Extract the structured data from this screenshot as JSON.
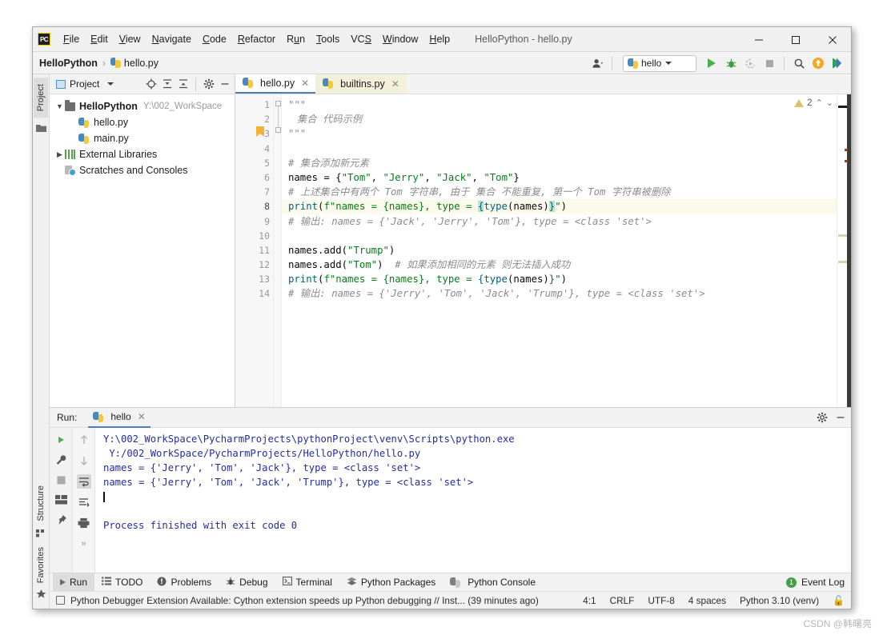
{
  "window": {
    "title": "HelloPython - hello.py",
    "logo": "pycharm-logo",
    "controls": {
      "minimize": "minimize-icon",
      "maximize": "maximize-icon",
      "close": "close-icon"
    }
  },
  "menubar": {
    "items": [
      {
        "label": "File",
        "mnemonic": "F"
      },
      {
        "label": "Edit",
        "mnemonic": "E"
      },
      {
        "label": "View",
        "mnemonic": "V"
      },
      {
        "label": "Navigate",
        "mnemonic": "N"
      },
      {
        "label": "Code",
        "mnemonic": "C"
      },
      {
        "label": "Refactor",
        "mnemonic": "R"
      },
      {
        "label": "Run",
        "mnemonic": "n"
      },
      {
        "label": "Tools",
        "mnemonic": "T"
      },
      {
        "label": "VCS",
        "mnemonic": "S"
      },
      {
        "label": "Window",
        "mnemonic": "W"
      },
      {
        "label": "Help",
        "mnemonic": "H"
      }
    ]
  },
  "navbar": {
    "breadcrumb": {
      "project": "HelloPython",
      "separator": "›",
      "file": "hello.py"
    },
    "run_config": "hello",
    "icons": {
      "account": "account-icon",
      "run": "run-icon",
      "debug": "debug-icon",
      "run_coverage": "run-with-coverage-icon",
      "stop": "stop-icon",
      "search": "search-everywhere-icon",
      "update": "update-project-icon",
      "next": "next-icon"
    }
  },
  "left_rail": {
    "top_label": "Project",
    "bottom_labels": [
      "Structure",
      "Favorites"
    ]
  },
  "project_panel": {
    "title": "Project",
    "actions": [
      "locate-icon",
      "collapse-all-icon",
      "expand-all-icon",
      "gear-icon",
      "hide-icon"
    ],
    "tree": [
      {
        "name": "HelloPython",
        "path": "Y:\\002_WorkSpace",
        "type": "folder",
        "expanded": true,
        "depth": 0,
        "bold": true
      },
      {
        "name": "hello.py",
        "path": "",
        "type": "python-file",
        "depth": 1,
        "bold": false
      },
      {
        "name": "main.py",
        "path": "",
        "type": "python-file",
        "depth": 1,
        "bold": false
      },
      {
        "name": "External Libraries",
        "path": "",
        "type": "library",
        "expanded": false,
        "depth": 0,
        "bold": false
      },
      {
        "name": "Scratches and Consoles",
        "path": "",
        "type": "scratch",
        "depth": 0,
        "bold": false
      }
    ]
  },
  "editor": {
    "tabs": [
      {
        "label": "hello.py",
        "active": true
      },
      {
        "label": "builtins.py",
        "active": false
      }
    ],
    "warnings": {
      "count": "2",
      "icon": "warning-icon"
    },
    "bookmark_line": 3,
    "current_line": 8,
    "lines": [
      {
        "n": 1,
        "tokens": [
          {
            "t": "\"\"\"",
            "c": "cmt"
          }
        ]
      },
      {
        "n": 2,
        "tokens": [
          {
            "t": "集合 代码示例",
            "c": "cmt"
          }
        ]
      },
      {
        "n": 3,
        "tokens": [
          {
            "t": "\"\"\"",
            "c": "cmt"
          }
        ]
      },
      {
        "n": 4,
        "tokens": []
      },
      {
        "n": 5,
        "tokens": [
          {
            "t": "# 集合添加新元素",
            "c": "cmt"
          }
        ]
      },
      {
        "n": 6,
        "tokens": [
          {
            "t": "names ",
            "c": "pln"
          },
          {
            "t": "= ",
            "c": "pln"
          },
          {
            "t": "{",
            "c": "pln"
          },
          {
            "t": "\"Tom\"",
            "c": "str"
          },
          {
            "t": ", ",
            "c": "pln"
          },
          {
            "t": "\"Jerry\"",
            "c": "str"
          },
          {
            "t": ", ",
            "c": "pln"
          },
          {
            "t": "\"Jack\"",
            "c": "str"
          },
          {
            "t": ", ",
            "c": "pln"
          },
          {
            "t": "\"Tom\"",
            "c": "str"
          },
          {
            "t": "}",
            "c": "pln"
          }
        ]
      },
      {
        "n": 7,
        "tokens": [
          {
            "t": "# 上述集合中有两个 Tom 字符串, 由于 集合 不能重复, 第一个 Tom 字符串被删除",
            "c": "cmt"
          }
        ]
      },
      {
        "n": 8,
        "tokens": [
          {
            "t": "print",
            "c": "fn"
          },
          {
            "t": "(",
            "c": "pln"
          },
          {
            "t": "f\"names = {names}, type = ",
            "c": "str"
          },
          {
            "t": "{",
            "c": "bracehl"
          },
          {
            "t": "type",
            "c": "fn"
          },
          {
            "t": "(names)",
            "c": "pln"
          },
          {
            "t": "}",
            "c": "bracehl"
          },
          {
            "t": "\"",
            "c": "str"
          },
          {
            "t": ")",
            "c": "pln"
          }
        ]
      },
      {
        "n": 9,
        "tokens": [
          {
            "t": "# 输出: names = {'Jack', 'Jerry', 'Tom'}, type = <class 'set'>",
            "c": "cmt"
          }
        ]
      },
      {
        "n": 10,
        "tokens": []
      },
      {
        "n": 11,
        "tokens": [
          {
            "t": "names.add",
            "c": "pln"
          },
          {
            "t": "(",
            "c": "pln"
          },
          {
            "t": "\"Trump\"",
            "c": "str"
          },
          {
            "t": ")",
            "c": "pln"
          }
        ]
      },
      {
        "n": 12,
        "tokens": [
          {
            "t": "names.add",
            "c": "pln"
          },
          {
            "t": "(",
            "c": "pln"
          },
          {
            "t": "\"Tom\"",
            "c": "str"
          },
          {
            "t": ")  ",
            "c": "pln"
          },
          {
            "t": "# 如果添加相同的元素 则无法插入成功",
            "c": "cmt"
          }
        ]
      },
      {
        "n": 13,
        "tokens": [
          {
            "t": "print",
            "c": "fn"
          },
          {
            "t": "(",
            "c": "pln"
          },
          {
            "t": "f\"names = {names}, type = ",
            "c": "str"
          },
          {
            "t": "{",
            "c": "pln"
          },
          {
            "t": "type",
            "c": "fn"
          },
          {
            "t": "(names)",
            "c": "pln"
          },
          {
            "t": "}",
            "c": "pln"
          },
          {
            "t": "\"",
            "c": "str"
          },
          {
            "t": ")",
            "c": "pln"
          }
        ]
      },
      {
        "n": 14,
        "tokens": [
          {
            "t": "# 输出: names = {'Jerry', 'Tom', 'Jack', 'Trump'}, type = <class 'set'>",
            "c": "cmt"
          }
        ]
      }
    ]
  },
  "run_panel": {
    "label": "Run:",
    "tab": "hello",
    "toolbar_left": [
      "rerun-icon",
      "settings-wrench-icon",
      "stop-icon",
      "layout-icon",
      "pin-icon"
    ],
    "toolbar_right": [
      "up-icon",
      "down-icon",
      "soft-wrap-icon",
      "scroll-to-end-icon",
      "print-icon",
      "more-icon"
    ],
    "header_right": [
      "gear-icon",
      "hide-icon"
    ],
    "console": [
      "Y:\\002_WorkSpace\\PycharmProjects\\pythonProject\\venv\\Scripts\\python.exe",
      " Y:/002_WorkSpace/PycharmProjects/HelloPython/hello.py",
      "names = {'Jerry', 'Tom', 'Jack'}, type = <class 'set'>",
      "names = {'Jerry', 'Tom', 'Jack', 'Trump'}, type = <class 'set'>",
      "",
      "",
      "Process finished with exit code 0"
    ]
  },
  "bottom_bar": {
    "items": [
      {
        "label": "Run",
        "icon": "run-icon",
        "active": true
      },
      {
        "label": "TODO",
        "icon": "todo-icon",
        "active": false
      },
      {
        "label": "Problems",
        "icon": "problems-icon",
        "active": false
      },
      {
        "label": "Debug",
        "icon": "debug-icon",
        "active": false
      },
      {
        "label": "Terminal",
        "icon": "terminal-icon",
        "active": false
      },
      {
        "label": "Python Packages",
        "icon": "packages-icon",
        "active": false
      },
      {
        "label": "Python Console",
        "icon": "python-console-icon",
        "active": false
      }
    ],
    "event_log": {
      "label": "Event Log",
      "count": "1",
      "icon": "event-log-icon"
    }
  },
  "status_bar": {
    "message": "Python Debugger Extension Available: Cython extension speeds up Python debugging // Inst... (39 minutes ago)",
    "caret": "4:1",
    "line_separator": "CRLF",
    "encoding": "UTF-8",
    "indent": "4 spaces",
    "interpreter": "Python 3.10 (venv)",
    "lock_icon": "lock-icon"
  },
  "watermark": "CSDN @韩曙亮",
  "colors": {
    "accent": "#4d7fbd",
    "run_green": "#4caf50",
    "keyword": "#0033b3",
    "string": "#067d17",
    "comment": "#8c8c8c",
    "function": "#00627a",
    "console_text": "#232d9e",
    "brace_highlight": "#b6e2d8",
    "line_highlight": "#fcfaec"
  }
}
